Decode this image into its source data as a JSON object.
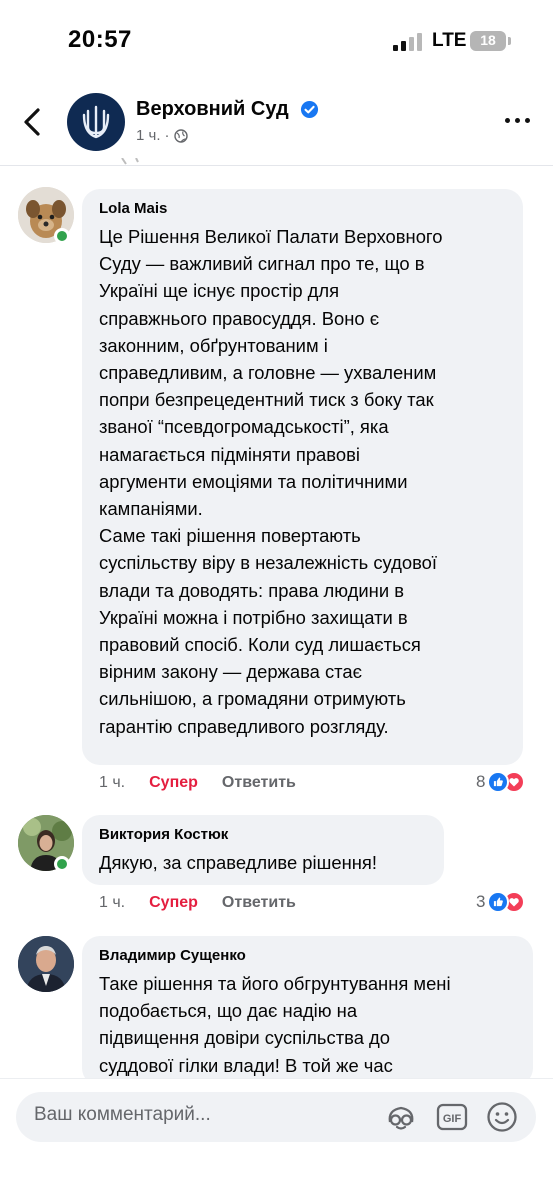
{
  "status_bar": {
    "time": "20:57",
    "network": "LTE",
    "battery": "18"
  },
  "header": {
    "page_name": "Верховний Суд",
    "time_ago": "1 ч.",
    "separator": "·",
    "icons": [
      "back-arrow-icon",
      "verified-badge-icon",
      "globe-icon",
      "more-icon"
    ]
  },
  "comments": [
    {
      "author": "Lola Mais",
      "text": "Це Рішення Великої Палати Верховного\nСуду — важливий сигнал про те, що в\nУкраїні ще існує простір для\nсправжнього правосуддя. Воно є\nзаконним, обґрунтованим і\nсправедливим, а головне — ухваленим\nпопри безпрецедентний тиск з боку так\nзваної “псевдогромадськості”, яка\nнамагається підміняти правові\nаргументи емоціями та політичними\nкампаніями.\nСаме такі рішення повертають\nсуспільству віру в незалежність судової\nвлади та доводять: права людини в\nУкраїні можна і потрібно захищати в\nправовий спосіб. Коли суд лишається\nвірним закону — держава стає\nсильнішою, а громадяни отримують\nгарантію справедливого розгляду.",
      "time": "1 ч.",
      "react_label": "Супер",
      "reply_label": "Ответить",
      "reaction_count": "8",
      "online": true
    },
    {
      "author": "Виктория Костюк",
      "text": "Дякую, за справедливе рішення!",
      "time": "1 ч.",
      "react_label": "Супер",
      "reply_label": "Ответить",
      "reaction_count": "3",
      "online": true
    },
    {
      "author": "Владимир Сущенко",
      "text": "Таке рішення та його обгрунтування мені\nподобається, що дає надію на\nпідвищення довіри суспільства до\nсуддової гілки влади! В той же час",
      "online": false
    }
  ],
  "composer": {
    "placeholder": "Ваш комментарий...",
    "icons": [
      "avatar-sticker-icon",
      "gif-icon",
      "emoji-icon"
    ]
  },
  "colors": {
    "accent": "#1877f2",
    "super": "#e41e3f",
    "love": "#f33e58",
    "bubble": "#f0f2f5",
    "online": "#31a24c"
  }
}
